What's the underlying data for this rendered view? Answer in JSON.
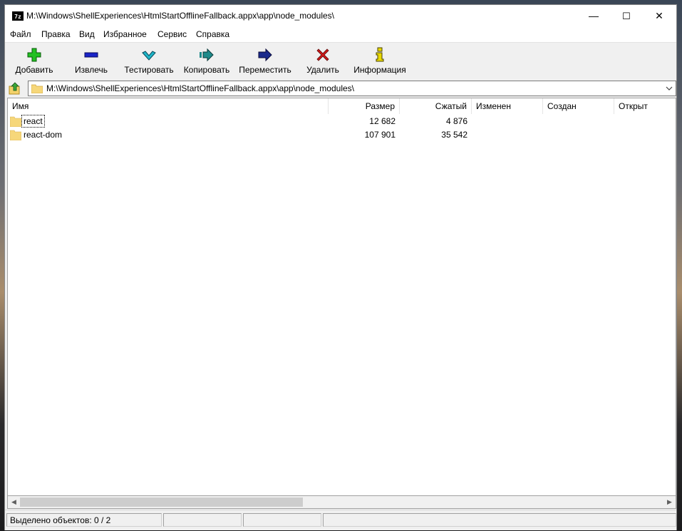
{
  "window": {
    "title": "M:\\Windows\\ShellExperiences\\HtmlStartOfflineFallback.appx\\app\\node_modules\\",
    "icon_text": "7z",
    "controls": {
      "minimize": "—",
      "maximize": "☐",
      "close": "✕"
    }
  },
  "menu": [
    "Файл",
    "Правка",
    "Вид",
    "Избранное",
    "Сервис",
    "Справка"
  ],
  "toolbar": {
    "add": "Добавить",
    "extract": "Извлечь",
    "test": "Тестировать",
    "copy": "Копировать",
    "move": "Переместить",
    "delete": "Удалить",
    "info": "Информация"
  },
  "address": {
    "path": "M:\\Windows\\ShellExperiences\\HtmlStartOfflineFallback.appx\\app\\node_modules\\"
  },
  "columns": [
    "Имя",
    "Размер",
    "Сжатый",
    "Изменен",
    "Создан",
    "Открыт"
  ],
  "files": [
    {
      "name": "react",
      "size": "12 682",
      "packed": "4 876",
      "modified": "",
      "created": "",
      "accessed": ""
    },
    {
      "name": "react-dom",
      "size": "107 901",
      "packed": "35 542",
      "modified": "",
      "created": "",
      "accessed": ""
    }
  ],
  "status": {
    "selected": "Выделено объектов: 0 / 2"
  },
  "colors": {
    "add_icon": "#22c022",
    "extract_icon": "#1a24c8",
    "test_icon": "#1fb6c8",
    "copy_icon": "#1f8a8a",
    "move_icon": "#1a2a8c",
    "delete_icon": "#d01818",
    "info_icon": "#e8d800"
  }
}
